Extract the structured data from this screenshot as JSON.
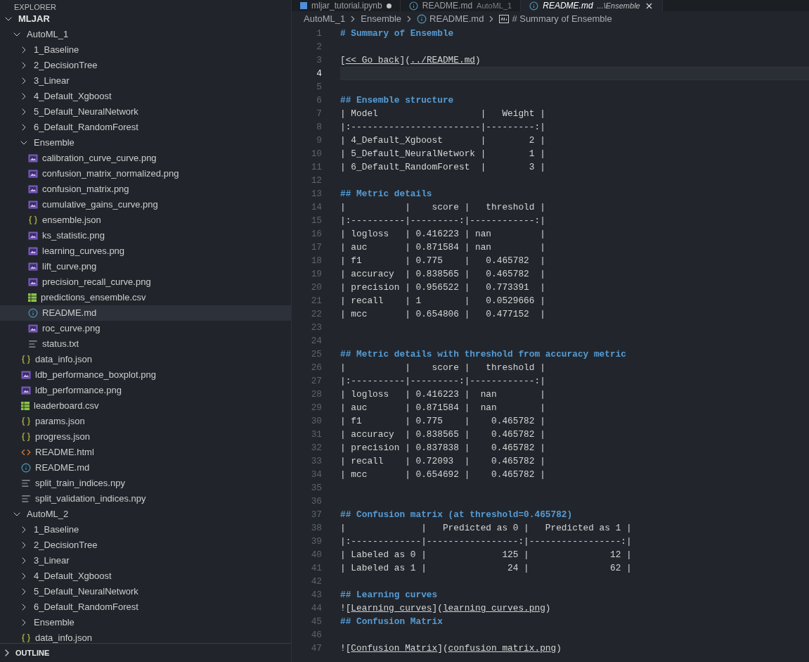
{
  "explorer": {
    "title": "EXPLORER"
  },
  "tree": [
    {
      "label": "MLJAR",
      "kind": "root",
      "expanded": true,
      "selected": false,
      "children": [
        {
          "label": "AutoML_1",
          "kind": "folder",
          "expanded": true,
          "selected": false,
          "children": [
            {
              "label": "1_Baseline",
              "kind": "folder",
              "expanded": false,
              "selected": false
            },
            {
              "label": "2_DecisionTree",
              "kind": "folder",
              "expanded": false,
              "selected": false
            },
            {
              "label": "3_Linear",
              "kind": "folder",
              "expanded": false,
              "selected": false
            },
            {
              "label": "4_Default_Xgboost",
              "kind": "folder",
              "expanded": false,
              "selected": false
            },
            {
              "label": "5_Default_NeuralNetwork",
              "kind": "folder",
              "expanded": false,
              "selected": false
            },
            {
              "label": "6_Default_RandomForest",
              "kind": "folder",
              "expanded": false,
              "selected": false
            },
            {
              "label": "Ensemble",
              "kind": "folder",
              "expanded": true,
              "selected": false,
              "children": [
                {
                  "label": "calibration_curve_curve.png",
                  "kind": "image",
                  "selected": false
                },
                {
                  "label": "confusion_matrix_normalized.png",
                  "kind": "image",
                  "selected": false
                },
                {
                  "label": "confusion_matrix.png",
                  "kind": "image",
                  "selected": false
                },
                {
                  "label": "cumulative_gains_curve.png",
                  "kind": "image",
                  "selected": false
                },
                {
                  "label": "ensemble.json",
                  "kind": "json",
                  "selected": false
                },
                {
                  "label": "ks_statistic.png",
                  "kind": "image",
                  "selected": false
                },
                {
                  "label": "learning_curves.png",
                  "kind": "image",
                  "selected": false
                },
                {
                  "label": "lift_curve.png",
                  "kind": "image",
                  "selected": false
                },
                {
                  "label": "precision_recall_curve.png",
                  "kind": "image",
                  "selected": false
                },
                {
                  "label": "predictions_ensemble.csv",
                  "kind": "csv",
                  "selected": false
                },
                {
                  "label": "README.md",
                  "kind": "markdown",
                  "selected": true
                },
                {
                  "label": "roc_curve.png",
                  "kind": "image",
                  "selected": false
                },
                {
                  "label": "status.txt",
                  "kind": "text",
                  "selected": false
                }
              ]
            },
            {
              "label": "data_info.json",
              "kind": "json",
              "selected": false
            },
            {
              "label": "ldb_performance_boxplot.png",
              "kind": "image",
              "selected": false
            },
            {
              "label": "ldb_performance.png",
              "kind": "image",
              "selected": false
            },
            {
              "label": "leaderboard.csv",
              "kind": "csv",
              "selected": false
            },
            {
              "label": "params.json",
              "kind": "json",
              "selected": false
            },
            {
              "label": "progress.json",
              "kind": "json",
              "selected": false
            },
            {
              "label": "README.html",
              "kind": "html",
              "selected": false
            },
            {
              "label": "README.md",
              "kind": "markdown",
              "selected": false
            },
            {
              "label": "split_train_indices.npy",
              "kind": "text",
              "selected": false
            },
            {
              "label": "split_validation_indices.npy",
              "kind": "text",
              "selected": false
            }
          ]
        },
        {
          "label": "AutoML_2",
          "kind": "folder",
          "expanded": true,
          "selected": false,
          "children": [
            {
              "label": "1_Baseline",
              "kind": "folder",
              "expanded": false,
              "selected": false
            },
            {
              "label": "2_DecisionTree",
              "kind": "folder",
              "expanded": false,
              "selected": false
            },
            {
              "label": "3_Linear",
              "kind": "folder",
              "expanded": false,
              "selected": false
            },
            {
              "label": "4_Default_Xgboost",
              "kind": "folder",
              "expanded": false,
              "selected": false
            },
            {
              "label": "5_Default_NeuralNetwork",
              "kind": "folder",
              "expanded": false,
              "selected": false
            },
            {
              "label": "6_Default_RandomForest",
              "kind": "folder",
              "expanded": false,
              "selected": false
            },
            {
              "label": "Ensemble",
              "kind": "folder",
              "expanded": false,
              "selected": false
            },
            {
              "label": "data_info.json",
              "kind": "json",
              "selected": false
            }
          ]
        }
      ]
    }
  ],
  "outline": {
    "label": "OUTLINE",
    "expanded": false
  },
  "tabs": [
    {
      "label": "mljar_tutorial.ipynb",
      "kind": "notebook",
      "modified": true,
      "selected": false
    },
    {
      "label": "README.md",
      "description": "AutoML_1",
      "kind": "markdown",
      "modified": false,
      "selected": false
    },
    {
      "label": "README.md",
      "description": "...\\Ensemble",
      "kind": "markdown",
      "modified": false,
      "selected": true
    }
  ],
  "breadcrumbs": [
    {
      "label": "AutoML_1",
      "kind": "folder"
    },
    {
      "label": "Ensemble",
      "kind": "folder"
    },
    {
      "label": "README.md",
      "kind": "markdown"
    },
    {
      "label": "# Summary of Ensemble",
      "kind": "symbol"
    }
  ],
  "lines": [
    {
      "number": "1",
      "current": false,
      "segments": [
        {
          "kind": "heading",
          "text": "# Summary of Ensemble"
        }
      ]
    },
    {
      "number": "2",
      "current": false
    },
    {
      "number": "3",
      "current": false,
      "segments": [
        {
          "kind": "text",
          "text": "["
        },
        {
          "kind": "link",
          "text": "<< Go back"
        },
        {
          "kind": "text",
          "text": "]("
        },
        {
          "kind": "link",
          "text": "../README.md"
        },
        {
          "kind": "text",
          "text": ")"
        }
      ]
    },
    {
      "number": "4",
      "current": true
    },
    {
      "number": "5",
      "current": false
    },
    {
      "number": "6",
      "current": false,
      "segments": [
        {
          "kind": "heading",
          "text": "## Ensemble structure"
        }
      ]
    },
    {
      "number": "7",
      "current": false,
      "segments": [
        {
          "kind": "text",
          "text": "| Model                   |   Weight |"
        }
      ]
    },
    {
      "number": "8",
      "current": false,
      "segments": [
        {
          "kind": "text",
          "text": "|:------------------------|---------:|"
        }
      ]
    },
    {
      "number": "9",
      "current": false,
      "segments": [
        {
          "kind": "text",
          "text": "| 4_Default_Xgboost       |        2 |"
        }
      ]
    },
    {
      "number": "10",
      "current": false,
      "segments": [
        {
          "kind": "text",
          "text": "| 5_Default_NeuralNetwork |        1 |"
        }
      ]
    },
    {
      "number": "11",
      "current": false,
      "segments": [
        {
          "kind": "text",
          "text": "| 6_Default_RandomForest  |        3 |"
        }
      ]
    },
    {
      "number": "12",
      "current": false
    },
    {
      "number": "13",
      "current": false,
      "segments": [
        {
          "kind": "heading",
          "text": "## Metric details"
        }
      ]
    },
    {
      "number": "14",
      "current": false,
      "segments": [
        {
          "kind": "text",
          "text": "|           |    score |   threshold |"
        }
      ]
    },
    {
      "number": "15",
      "current": false,
      "segments": [
        {
          "kind": "text",
          "text": "|:----------|---------:|------------:|"
        }
      ]
    },
    {
      "number": "16",
      "current": false,
      "segments": [
        {
          "kind": "text",
          "text": "| logloss   | 0.416223 | nan         |"
        }
      ]
    },
    {
      "number": "17",
      "current": false,
      "segments": [
        {
          "kind": "text",
          "text": "| auc       | 0.871584 | nan         |"
        }
      ]
    },
    {
      "number": "18",
      "current": false,
      "segments": [
        {
          "kind": "text",
          "text": "| f1        | 0.775    |   0.465782  |"
        }
      ]
    },
    {
      "number": "19",
      "current": false,
      "segments": [
        {
          "kind": "text",
          "text": "| accuracy  | 0.838565 |   0.465782  |"
        }
      ]
    },
    {
      "number": "20",
      "current": false,
      "segments": [
        {
          "kind": "text",
          "text": "| precision | 0.956522 |   0.773391  |"
        }
      ]
    },
    {
      "number": "21",
      "current": false,
      "segments": [
        {
          "kind": "text",
          "text": "| recall    | 1        |   0.0529666 |"
        }
      ]
    },
    {
      "number": "22",
      "current": false,
      "segments": [
        {
          "kind": "text",
          "text": "| mcc       | 0.654806 |   0.477152  |"
        }
      ]
    },
    {
      "number": "23",
      "current": false
    },
    {
      "number": "24",
      "current": false
    },
    {
      "number": "25",
      "current": false,
      "segments": [
        {
          "kind": "heading",
          "text": "## Metric details with threshold from accuracy metric"
        }
      ]
    },
    {
      "number": "26",
      "current": false,
      "segments": [
        {
          "kind": "text",
          "text": "|           |    score |   threshold |"
        }
      ]
    },
    {
      "number": "27",
      "current": false,
      "segments": [
        {
          "kind": "text",
          "text": "|:----------|---------:|------------:|"
        }
      ]
    },
    {
      "number": "28",
      "current": false,
      "segments": [
        {
          "kind": "text",
          "text": "| logloss   | 0.416223 |  nan        |"
        }
      ]
    },
    {
      "number": "29",
      "current": false,
      "segments": [
        {
          "kind": "text",
          "text": "| auc       | 0.871584 |  nan        |"
        }
      ]
    },
    {
      "number": "30",
      "current": false,
      "segments": [
        {
          "kind": "text",
          "text": "| f1        | 0.775    |    0.465782 |"
        }
      ]
    },
    {
      "number": "31",
      "current": false,
      "segments": [
        {
          "kind": "text",
          "text": "| accuracy  | 0.838565 |    0.465782 |"
        }
      ]
    },
    {
      "number": "32",
      "current": false,
      "segments": [
        {
          "kind": "text",
          "text": "| precision | 0.837838 |    0.465782 |"
        }
      ]
    },
    {
      "number": "33",
      "current": false,
      "segments": [
        {
          "kind": "text",
          "text": "| recall    | 0.72093  |    0.465782 |"
        }
      ]
    },
    {
      "number": "34",
      "current": false,
      "segments": [
        {
          "kind": "text",
          "text": "| mcc       | 0.654692 |    0.465782 |"
        }
      ]
    },
    {
      "number": "35",
      "current": false
    },
    {
      "number": "36",
      "current": false
    },
    {
      "number": "37",
      "current": false,
      "segments": [
        {
          "kind": "heading",
          "text": "## Confusion matrix (at threshold=0.465782)"
        }
      ]
    },
    {
      "number": "38",
      "current": false,
      "segments": [
        {
          "kind": "text",
          "text": "|              |   Predicted as 0 |   Predicted as 1 |"
        }
      ]
    },
    {
      "number": "39",
      "current": false,
      "segments": [
        {
          "kind": "text",
          "text": "|:-------------|-----------------:|-----------------:|"
        }
      ]
    },
    {
      "number": "40",
      "current": false,
      "segments": [
        {
          "kind": "text",
          "text": "| Labeled as 0 |              125 |               12 |"
        }
      ]
    },
    {
      "number": "41",
      "current": false,
      "segments": [
        {
          "kind": "text",
          "text": "| Labeled as 1 |               24 |               62 |"
        }
      ]
    },
    {
      "number": "42",
      "current": false
    },
    {
      "number": "43",
      "current": false,
      "segments": [
        {
          "kind": "heading",
          "text": "## Learning curves"
        }
      ]
    },
    {
      "number": "44",
      "current": false,
      "segments": [
        {
          "kind": "text",
          "text": "!["
        },
        {
          "kind": "link",
          "text": "Learning curves"
        },
        {
          "kind": "text",
          "text": "]("
        },
        {
          "kind": "link",
          "text": "learning_curves.png"
        },
        {
          "kind": "text",
          "text": ")"
        }
      ]
    },
    {
      "number": "45",
      "current": false,
      "segments": [
        {
          "kind": "heading",
          "text": "## Confusion Matrix"
        }
      ]
    },
    {
      "number": "46",
      "current": false
    },
    {
      "number": "47",
      "current": false,
      "segments": [
        {
          "kind": "text",
          "text": "!["
        },
        {
          "kind": "link",
          "text": "Confusion Matrix"
        },
        {
          "kind": "text",
          "text": "]("
        },
        {
          "kind": "link",
          "text": "confusion_matrix.png"
        },
        {
          "kind": "text",
          "text": ")"
        }
      ]
    }
  ]
}
